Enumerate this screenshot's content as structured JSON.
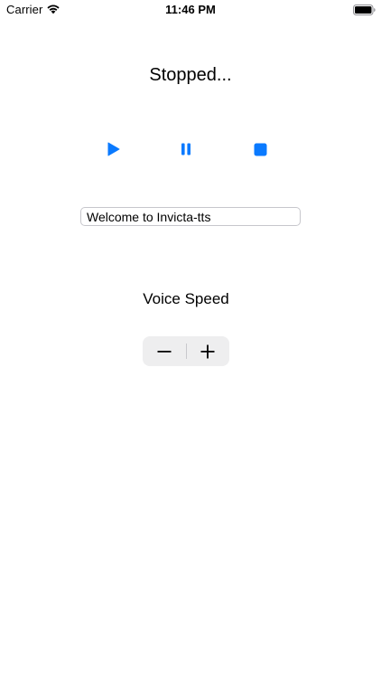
{
  "status_bar": {
    "carrier": "Carrier",
    "time": "11:46 PM",
    "wifi_icon": "wifi-icon",
    "battery_icon": "battery-icon"
  },
  "player": {
    "status_text": "Stopped...",
    "play_icon": "play-icon",
    "pause_icon": "pause-icon",
    "stop_icon": "stop-icon",
    "accent_color": "#0a7aff"
  },
  "text_input": {
    "value": "Welcome to Invicta-tts"
  },
  "voice_speed": {
    "label": "Voice Speed",
    "decrement_icon": "minus-icon",
    "increment_icon": "plus-icon"
  }
}
